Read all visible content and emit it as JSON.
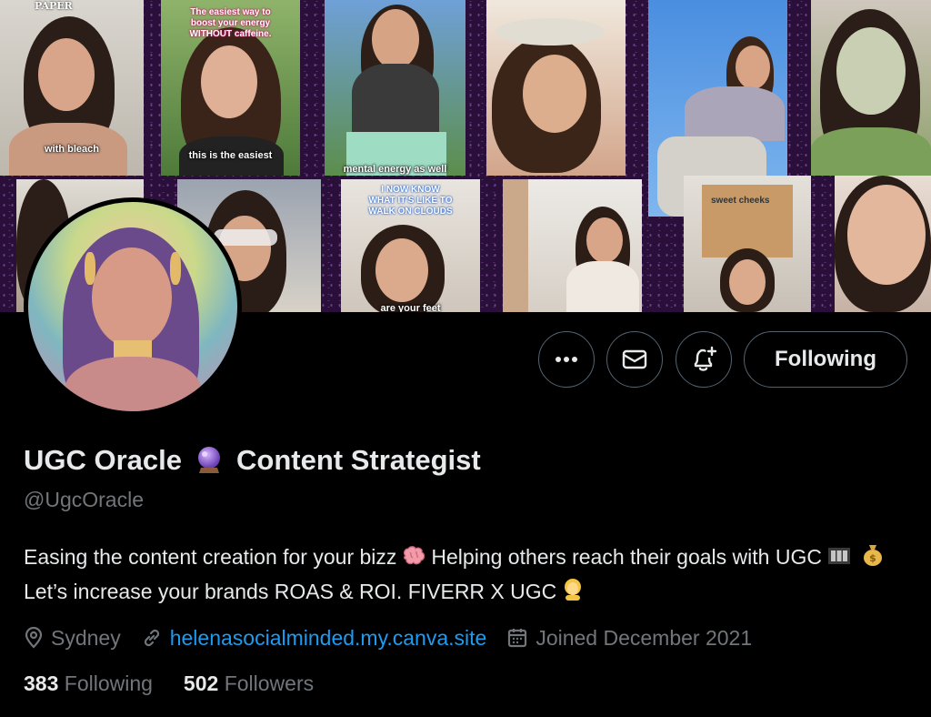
{
  "banner": {
    "captions": {
      "tile1_top": "PAPER",
      "tile1": "with bleach",
      "tile2_top": "The easiest way to boost your energy WITHOUT caffeine.",
      "tile2": "this is the easiest",
      "tile3": "mental energy as well",
      "tile4_top": "I NOW KNOW WHAT IT'S LIKE TO WALK ON CLOUDS",
      "tile4": "are your feet",
      "tile5": "sweet cheeks"
    }
  },
  "actions": {
    "more_icon": "ellipsis-icon",
    "message_icon": "envelope-icon",
    "notify_icon": "bell-plus-icon",
    "following_label": "Following"
  },
  "profile": {
    "name_part1": "UGC Oracle",
    "name_emoji": "crystal-ball-emoji",
    "name_part2": "Content Strategist",
    "handle": "@UgcOracle",
    "bio": {
      "seg1": "Easing the content creation for your bizz",
      "seg2": "Helping others reach their goals with UGC",
      "seg3": "Let’s increase your brands ROAS & ROI. FIVERR X UGC"
    },
    "location": "Sydney",
    "website": "helenasocialminded.my.canva.site",
    "joined": "Joined December 2021"
  },
  "stats": {
    "following_count": "383",
    "following_label": "Following",
    "followers_count": "502",
    "followers_label": "Followers"
  },
  "colors": {
    "background": "#000000",
    "text": "#e7e9ea",
    "muted": "#71767b",
    "link": "#1d9bf0",
    "border": "#536471",
    "banner_frame": "#2a0f3a"
  }
}
